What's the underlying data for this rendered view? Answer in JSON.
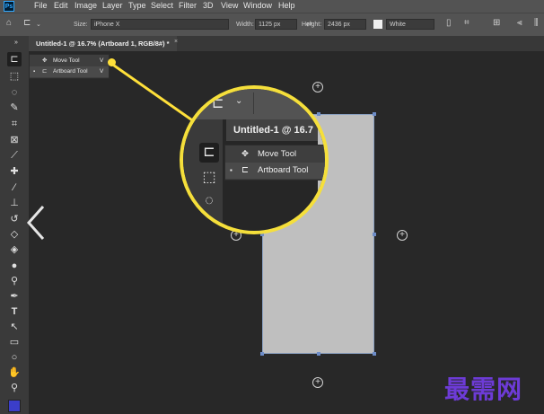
{
  "menubar": {
    "logo": "Ps",
    "items": [
      "File",
      "Edit",
      "Image",
      "Layer",
      "Type",
      "Select",
      "Filter",
      "3D",
      "View",
      "Window",
      "Help"
    ]
  },
  "options": {
    "size_label": "Size:",
    "size_value": "iPhone X",
    "width_label": "Width:",
    "width_value": "1125 px",
    "height_label": "Height:",
    "height_value": "2436 px",
    "background_value": "White"
  },
  "document": {
    "tab_title": "Untitled-1 @ 16.7% (Artboard 1, RGB/8#) *",
    "close_glyph": "×"
  },
  "flyout": {
    "items": [
      {
        "label": "Move Tool",
        "shortcut": "V"
      },
      {
        "label": "Artboard Tool",
        "shortcut": "V"
      }
    ]
  },
  "magnifier": {
    "tab_title": "Untitled-1 @ 16.7",
    "items": [
      {
        "label": "Move Tool"
      },
      {
        "label": "Artboard Tool"
      }
    ]
  },
  "watermark": "最需网",
  "colors": {
    "callout": "#ffe03a",
    "artboard": "#bfbfbf",
    "foreground_swatch": "#3b3ec9"
  }
}
